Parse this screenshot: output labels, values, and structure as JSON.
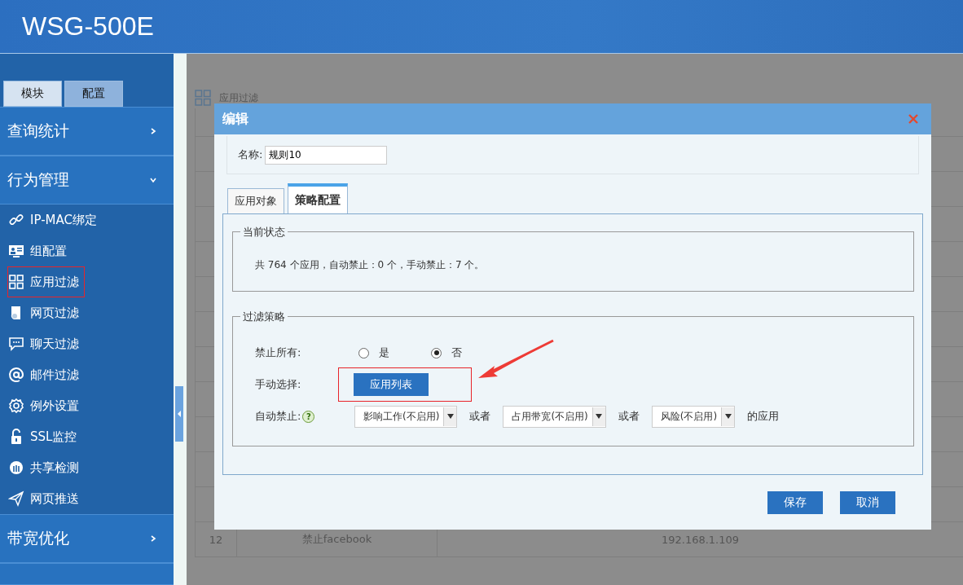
{
  "header": {
    "title": "WSG-500E"
  },
  "sidebar": {
    "tabs": [
      {
        "label": "模块",
        "selected": false
      },
      {
        "label": "配置",
        "selected": true
      }
    ],
    "sections": [
      {
        "label": "查询统计",
        "expanded": false
      },
      {
        "label": "行为管理",
        "expanded": true,
        "items": [
          {
            "label": "IP-MAC绑定",
            "annotated": false
          },
          {
            "label": "组配置",
            "annotated": false
          },
          {
            "label": "应用过滤",
            "annotated": true
          },
          {
            "label": "网页过滤",
            "annotated": false
          },
          {
            "label": "聊天过滤",
            "annotated": false
          },
          {
            "label": "邮件过滤",
            "annotated": false
          },
          {
            "label": "例外设置",
            "annotated": false
          },
          {
            "label": "SSL监控",
            "annotated": false
          },
          {
            "label": "共享检测",
            "annotated": false
          },
          {
            "label": "网页推送",
            "annotated": false
          }
        ]
      },
      {
        "label": "带宽优化",
        "expanded": false
      }
    ]
  },
  "page": {
    "title": "应用过滤",
    "rows": [
      {
        "cells": [
          "12",
          "禁止facebook",
          "192.168.1.109"
        ]
      }
    ]
  },
  "dialog": {
    "title": "编辑",
    "name": {
      "label": "名称:",
      "value": "规则10"
    },
    "tabs": [
      {
        "label": "应用对象",
        "selected": false
      },
      {
        "label": "策略配置",
        "selected": true
      }
    ],
    "status": {
      "legend": "当前状态",
      "text": "共 764 个应用，自动禁止：0 个，手动禁止：7 个。"
    },
    "policy": {
      "legend": "过滤策略",
      "block_all": {
        "label": "禁止所有:",
        "options": [
          {
            "label": "是",
            "selected": false
          },
          {
            "label": "否",
            "selected": true
          }
        ]
      },
      "manual": {
        "label": "手动选择:",
        "button": "应用列表",
        "annotated": true
      },
      "auto": {
        "label": "自动禁止:",
        "help": "?",
        "selects": [
          {
            "value": "影响工作(不启用)"
          },
          {
            "value": "占用带宽(不启用)"
          },
          {
            "value": "风险(不启用)"
          }
        ],
        "joiners": [
          "或者",
          "或者"
        ],
        "suffix": "的应用"
      }
    },
    "buttons": [
      "保存",
      "取消"
    ]
  }
}
